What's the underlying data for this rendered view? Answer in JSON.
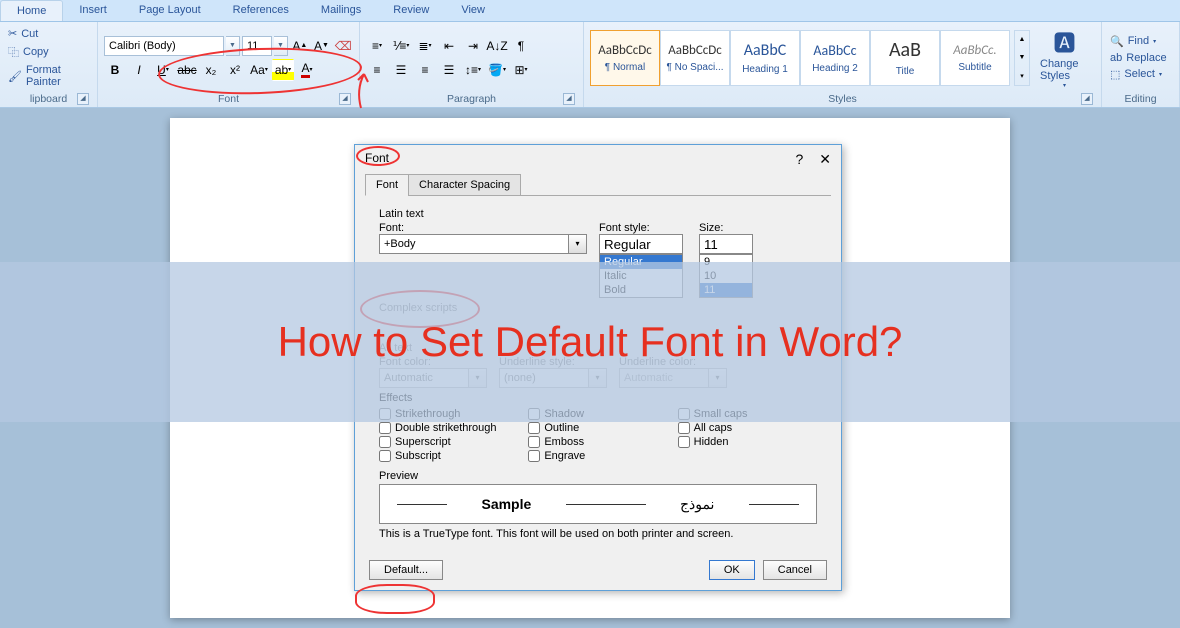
{
  "tabs": [
    "Home",
    "Insert",
    "Page Layout",
    "References",
    "Mailings",
    "Review",
    "View"
  ],
  "activeTab": "Home",
  "clipboard": {
    "cut": "Cut",
    "copy": "Copy",
    "paint": "Format Painter",
    "label": "lipboard"
  },
  "font": {
    "name": "Calibri (Body)",
    "size": "11",
    "label": "Font",
    "btns1": [
      "Aᐃ",
      "Aᐁ",
      "Aa",
      "✎"
    ],
    "btns2": [
      "B",
      "I",
      "U",
      "abc",
      "x₂",
      "x²",
      "Aa",
      "🖍",
      "A"
    ]
  },
  "paragraph": {
    "label": "Paragraph"
  },
  "styles": {
    "label": "Styles",
    "items": [
      {
        "sample": "AaBbCcDc",
        "name": "¶ Normal"
      },
      {
        "sample": "AaBbCcDc",
        "name": "¶ No Spaci..."
      },
      {
        "sample": "AaBbC",
        "name": "Heading 1"
      },
      {
        "sample": "AaBbCc",
        "name": "Heading 2"
      },
      {
        "sample": "AaB",
        "name": "Title"
      },
      {
        "sample": "AaBbCc.",
        "name": "Subtitle"
      }
    ],
    "change": "Change Styles"
  },
  "editing": {
    "label": "Editing",
    "find": "Find",
    "replace": "Replace",
    "select": "Select"
  },
  "dialog": {
    "title": "Font",
    "help": "?",
    "close": "✕",
    "tabs": [
      "Font",
      "Character Spacing"
    ],
    "latin_label": "Latin text",
    "font_label": "Font:",
    "font_val": "+Body",
    "style_label": "Font style:",
    "style_val": "Regular",
    "style_opts": [
      "Regular",
      "Italic",
      "Bold"
    ],
    "size_label": "Size:",
    "size_val": "11",
    "size_opts": [
      "9",
      "10",
      "11"
    ],
    "complex_label": "Complex scripts",
    "alltext_label": "All text",
    "color_label": "Font color:",
    "color_val": "Automatic",
    "ustyle_label": "Underline style:",
    "ustyle_val": "(none)",
    "ucolor_label": "Underline color:",
    "ucolor_val": "Automatic",
    "effects_label": "Effects",
    "effects": [
      "Strikethrough",
      "Double strikethrough",
      "Superscript",
      "Subscript",
      "Shadow",
      "Outline",
      "Emboss",
      "Engrave",
      "Small caps",
      "All caps",
      "Hidden"
    ],
    "preview_label": "Preview",
    "preview_s1": "Sample",
    "preview_s2": "نموذج",
    "note": "This is a TrueType font. This font will be used on both printer and screen.",
    "default_btn": "Default...",
    "ok": "OK",
    "cancel": "Cancel"
  },
  "overlay": "How to Set Default Font in Word?"
}
